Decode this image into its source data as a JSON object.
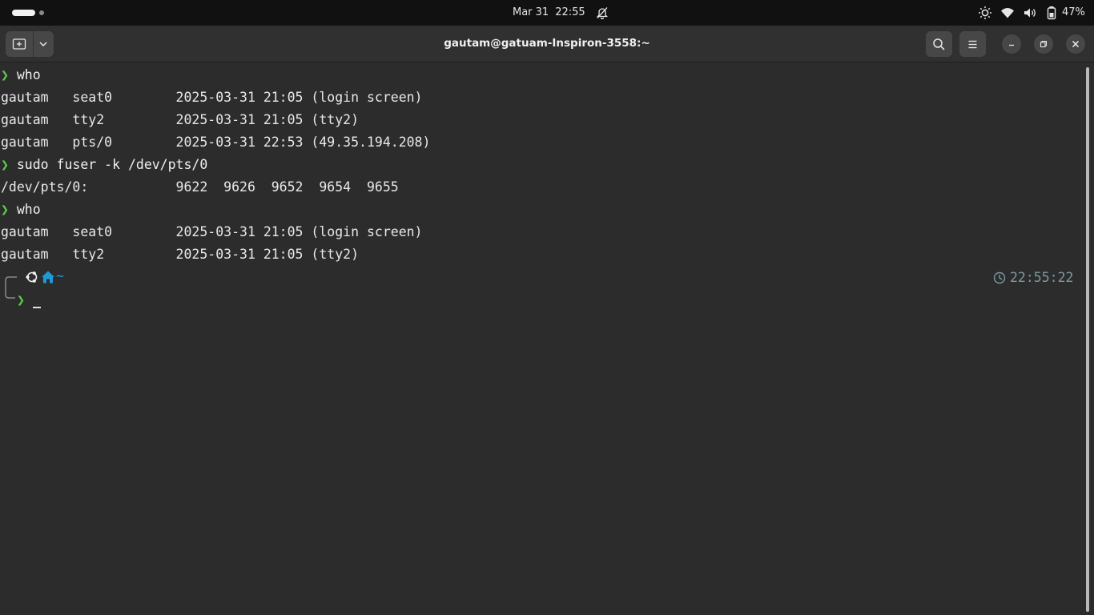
{
  "topbar": {
    "date": "Mar 31",
    "time": "22:55",
    "battery_percent": "47%",
    "icons": [
      "notifications-off-icon",
      "brightness-icon",
      "wifi-icon",
      "volume-icon",
      "battery-icon"
    ]
  },
  "window": {
    "title": "gautam@gatuam-Inspiron-3558:~"
  },
  "terminal": {
    "prompt_symbol": "❯",
    "lines": [
      {
        "type": "cmd",
        "text": "who"
      },
      {
        "type": "out",
        "text": "gautam   seat0        2025-03-31 21:05 (login screen)"
      },
      {
        "type": "out",
        "text": "gautam   tty2         2025-03-31 21:05 (tty2)"
      },
      {
        "type": "out",
        "text": "gautam   pts/0        2025-03-31 22:53 (49.35.194.208)"
      },
      {
        "type": "cmd",
        "text": "sudo fuser -k /dev/pts/0"
      },
      {
        "type": "out",
        "text": "/dev/pts/0:           9622  9626  9652  9654  9655"
      },
      {
        "type": "cmd",
        "text": "who"
      },
      {
        "type": "out",
        "text": "gautam   seat0        2025-03-31 21:05 (login screen)"
      },
      {
        "type": "out",
        "text": "gautam   tty2         2025-03-31 21:05 (tty2)"
      }
    ],
    "prompt_dir": "~",
    "prompt_time": "22:55:22",
    "colors": {
      "prompt_green": "#5bd14a",
      "home_blue": "#1e9ad6",
      "time_gray": "#7d9aa0"
    }
  }
}
